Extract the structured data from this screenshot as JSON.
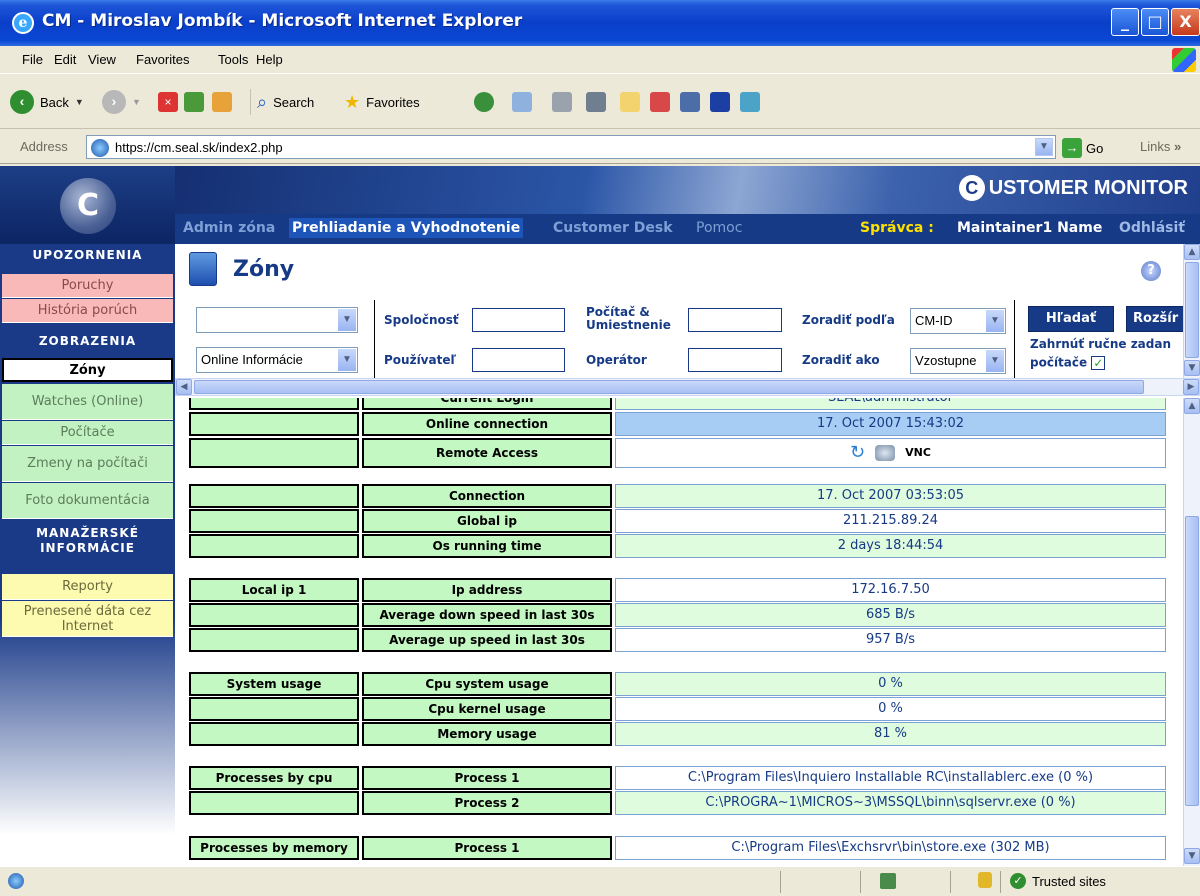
{
  "window": {
    "title": "CM - Miroslav Jombík - Microsoft Internet Explorer",
    "min": "_",
    "max": "□",
    "close": "X"
  },
  "menu": [
    "File",
    "Edit",
    "View",
    "Favorites",
    "Tools",
    "Help"
  ],
  "toolbar": {
    "back": "Back",
    "search": "Search",
    "favorites": "Favorites"
  },
  "address": {
    "label": "Address",
    "url": "https://cm.seal.sk/index2.php",
    "go": "Go",
    "links": "Links",
    "links_chevron": "»"
  },
  "brand": {
    "logo_letter": "C",
    "title": "USTOMER MONITOR"
  },
  "nav": {
    "items": [
      "Admin zóna",
      "Prehliadanie a Vyhodnotenie",
      "Customer Desk",
      "Pomoc"
    ],
    "user_label": "Správca :",
    "user_name": "Maintainer1 Name",
    "logout": "Odhlásiť"
  },
  "sidebar": {
    "sections": [
      "UPOZORNENIA",
      "ZOBRAZENIA",
      "MANAŽERSKÉ INFORMÁCIE"
    ],
    "items": [
      "Poruchy",
      "História porúch",
      "Zóny",
      "Watches (Online)",
      "Počítače",
      "Zmeny na počítači",
      "Foto dokumentácia",
      "Reporty",
      "Prenesené dáta cez Internet"
    ]
  },
  "page": {
    "title": "Zóny",
    "help": "?"
  },
  "filter": {
    "select1": "",
    "select2": "Online Informácie",
    "spolocnost": "Spoločnosť",
    "pouzivatel": "Používateľ",
    "pocitac": "Počítač & Umiestnenie",
    "operator": "Operátor",
    "sort_by": "Zoradiť podľa",
    "sort_by_value": "CM-ID",
    "sort_as": "Zoradiť ako",
    "sort_as_value": "Vzostupne",
    "search_btn": "Hľadať",
    "expand_btn": "Rozšír",
    "include_manual": "Zahrnúť ručne zadan",
    "computers": "počítače",
    "checkmark": "✓"
  },
  "table": {
    "cut_label": "Current Login",
    "cut_value": "SEAL\\administrator",
    "rows": [
      {
        "c1": "",
        "c2": "Online connection",
        "c3": "17. Oct 2007 15:43:02"
      },
      {
        "c1": "",
        "c2": "Remote Access",
        "c3": "VNC"
      },
      {
        "c1": "",
        "c2": "Connection",
        "c3": "17. Oct 2007 03:53:05"
      },
      {
        "c1": "",
        "c2": "Global ip",
        "c3": "211.215.89.24"
      },
      {
        "c1": "",
        "c2": "Os running time",
        "c3": "2 days 18:44:54"
      },
      {
        "c1": "Local ip 1",
        "c2": "Ip address",
        "c3": "172.16.7.50"
      },
      {
        "c1": "",
        "c2": "Average down speed in last 30s",
        "c3": "685 B/s"
      },
      {
        "c1": "",
        "c2": "Average up speed in last 30s",
        "c3": "957 B/s"
      },
      {
        "c1": "System usage",
        "c2": "Cpu system usage",
        "c3": "0 %"
      },
      {
        "c1": "",
        "c2": "Cpu kernel usage",
        "c3": "0 %"
      },
      {
        "c1": "",
        "c2": "Memory usage",
        "c3": "81 %"
      },
      {
        "c1": "Processes by cpu",
        "c2": "Process 1",
        "c3": "C:\\Program Files\\Inquiero Installable RC\\installablerc.exe (0 %)"
      },
      {
        "c1": "",
        "c2": "Process 2",
        "c3": "C:\\PROGRA~1\\MICROS~3\\MSSQL\\binn\\sqlservr.exe (0 %)"
      },
      {
        "c1": "Processes by memory",
        "c2": "Process 1",
        "c3": "C:\\Program Files\\Exchsrvr\\bin\\store.exe (302 MB)"
      }
    ]
  },
  "status": {
    "zone": "Trusted sites"
  }
}
